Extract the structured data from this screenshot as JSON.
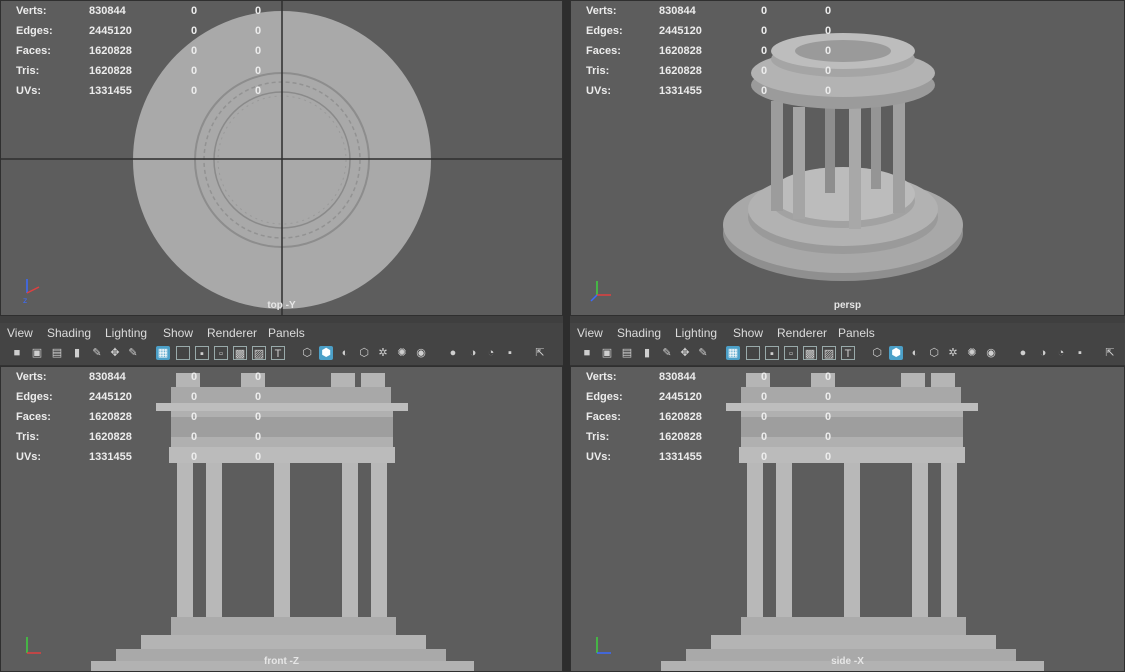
{
  "stats": {
    "labels": [
      "Verts:",
      "Edges:",
      "Faces:",
      "Tris:",
      "UVs:"
    ],
    "values": [
      "830844",
      "2445120",
      "1620828",
      "1620828",
      "1331455"
    ],
    "selected": [
      "0",
      "0",
      "0",
      "0",
      "0"
    ],
    "uv_selected": [
      "0",
      "0",
      "0",
      "0",
      "0"
    ]
  },
  "viewports": {
    "top_left": {
      "camera": "top -Y"
    },
    "top_right": {
      "camera": "persp"
    },
    "bottom_left": {
      "camera": "front -Z"
    },
    "bottom_right": {
      "camera": "side -X"
    }
  },
  "panel_menu": [
    "View",
    "Shading",
    "Lighting",
    "Show",
    "Renderer",
    "Panels"
  ],
  "toolbar_icons": [
    "camera-icon",
    "camera-attributes-icon",
    "bookmark-icon",
    "image-plane-icon",
    "grease-pencil-icon",
    "2d-pan-zoom-icon",
    "grid-icon",
    "film-gate-icon",
    "resolution-gate-icon",
    "gate-mask-icon",
    "field-chart-icon",
    "safe-action-icon",
    "safe-title-icon",
    "wireframe-icon",
    "smooth-shade-icon",
    "wireframe-on-shaded-icon",
    "textured-icon",
    "use-all-lights-icon",
    "shadows-icon",
    "ambient-occlusion-icon",
    "motion-blur-icon",
    "anti-aliasing-icon",
    "depth-of-field-icon",
    "isolate-select-icon",
    "xray-icon"
  ],
  "colors": {
    "viewport_bg": "#5d5d5d",
    "menubar_bg": "#444444",
    "active_icon": "#4ca0c8",
    "model_fill": "#b8b8b8"
  }
}
